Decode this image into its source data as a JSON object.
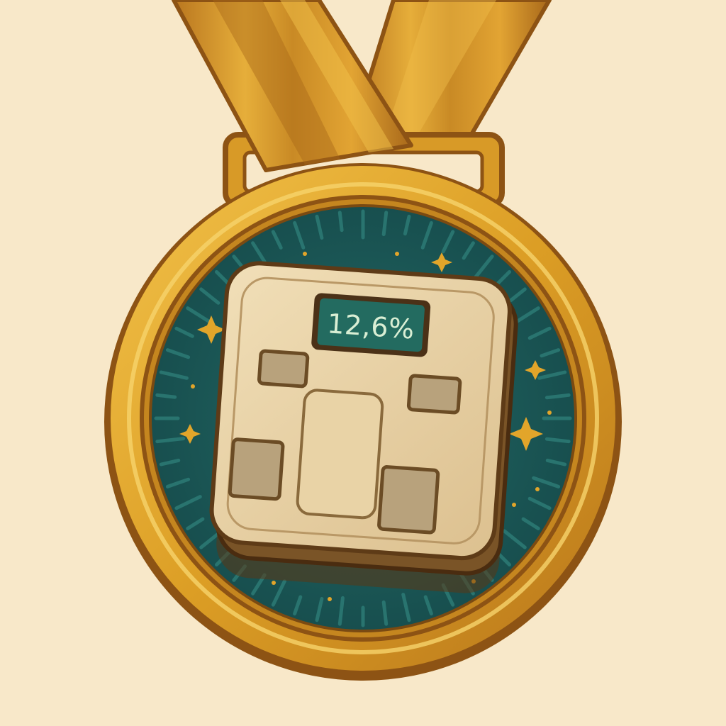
{
  "badge": {
    "display_value": "12,6%",
    "icon": "body-fat-scale-icon"
  },
  "colors": {
    "background": "#f8e8c9",
    "gold": "#e2a52a",
    "gold_dark": "#8d5314",
    "teal": "#1c5b5a",
    "scale_body": "#e8d2a6",
    "display_screen": "#236b60"
  }
}
